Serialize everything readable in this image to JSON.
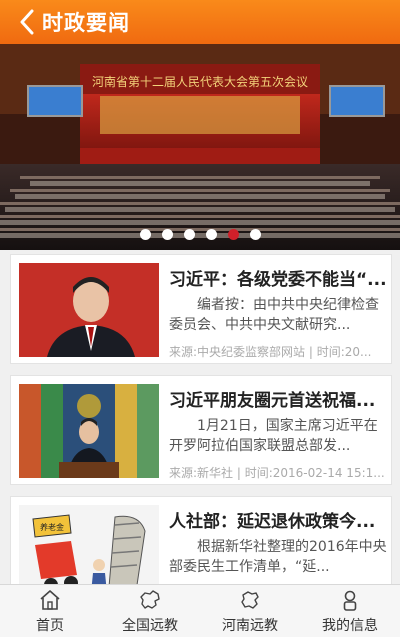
{
  "header": {
    "title": "时政要闻",
    "back_icon": "chevron-left-icon"
  },
  "banner": {
    "sign_text": "河南省第十二届人民代表大会第五次会议",
    "dots": 6,
    "active_dot": 4
  },
  "articles": [
    {
      "title": "习近平：各级党委不能当“...",
      "summary": "编者按：由中共中央纪律检查委员会、中共中央文献研究...",
      "meta": "来源:中央纪委监察部网站 | 时间:20..."
    },
    {
      "title": "习近平朋友圈元首送祝福...",
      "summary": "1月21日，国家主席习近平在开罗阿拉伯国家联盟总部发...",
      "meta": "来源:新华社 | 时间:2016-02-14 15:1..."
    },
    {
      "title": "人社部：延迟退休政策今...",
      "summary": "根据新华社整理的2016年中央部委民生工作清单，“延...",
      "meta": "",
      "thumb_text": "养老金"
    }
  ],
  "tabs": [
    {
      "label": "首页",
      "icon": "home-icon"
    },
    {
      "label": "全国远教",
      "icon": "china-map-icon"
    },
    {
      "label": "河南远教",
      "icon": "henan-map-icon"
    },
    {
      "label": "我的信息",
      "icon": "user-icon"
    }
  ],
  "colors": {
    "header": "#f47a14",
    "active_dot": "#d0202a"
  }
}
